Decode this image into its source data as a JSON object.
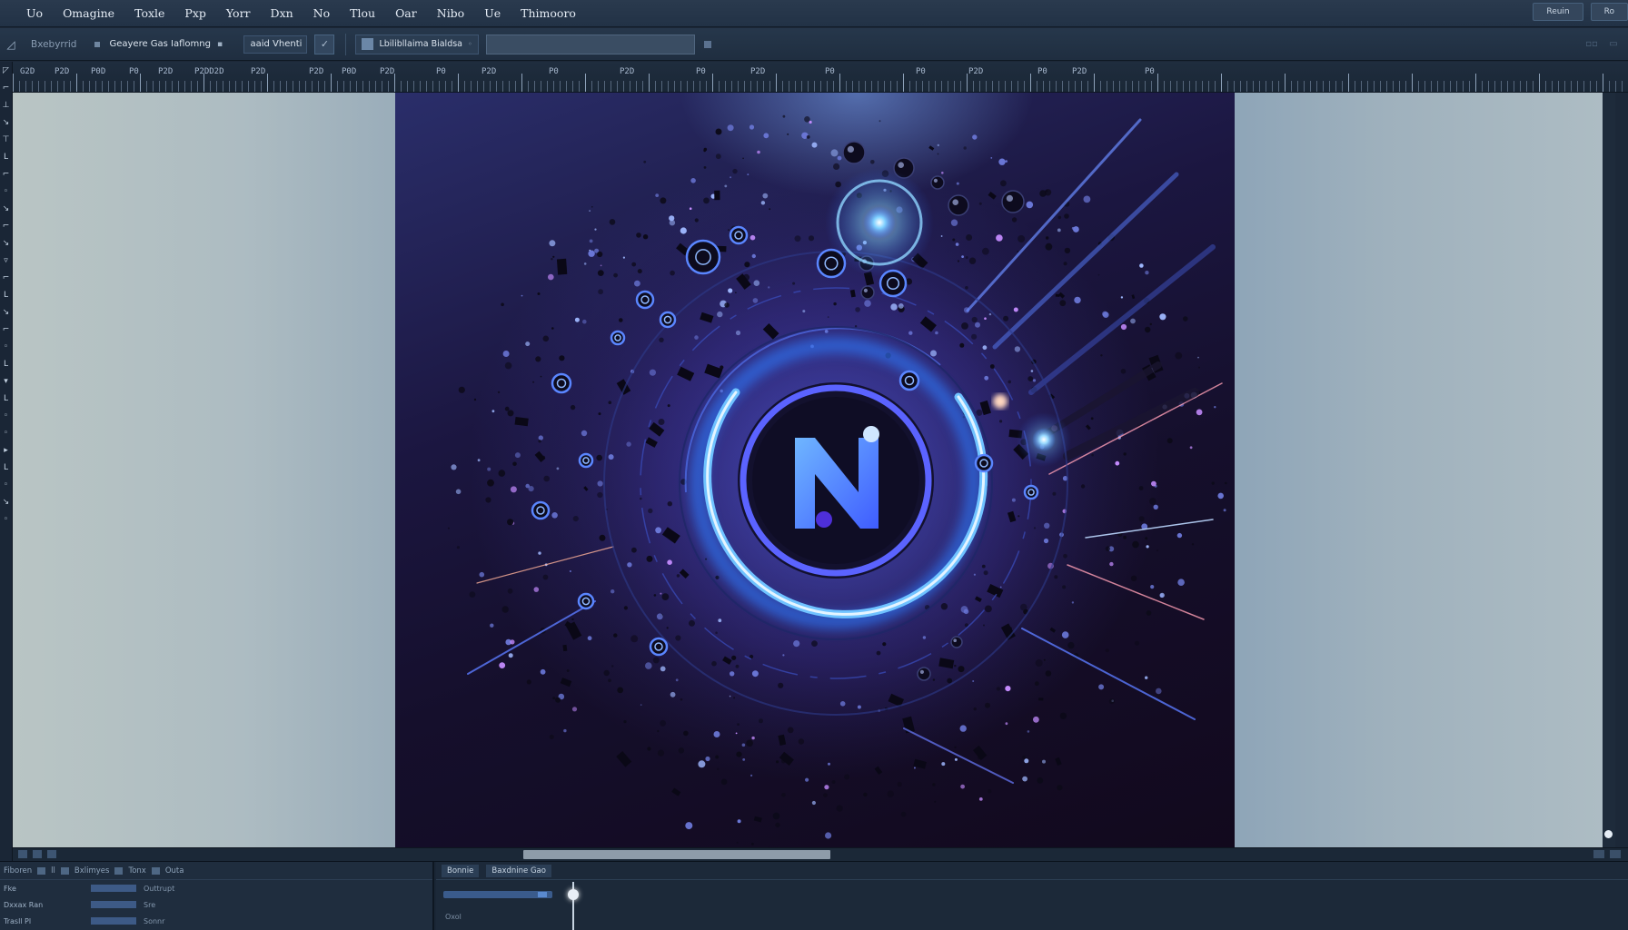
{
  "menubar": {
    "items": [
      "Uo",
      "Omagine",
      "Toxle",
      "Pxp",
      "Yorr",
      "Dxn",
      "No",
      "Tlou",
      "Oar",
      "Nibo",
      "Ue",
      "Thimooro"
    ],
    "right_buttons": [
      "Reuin",
      "Ro"
    ]
  },
  "optionsbar": {
    "label": "Bxebyrrid",
    "select_a": "Geayere Gas Iaflomng",
    "select_b": "aaid Vhenti",
    "preset": "Lbilibllaima Bialdsa"
  },
  "ruler": {
    "labels": [
      "G2D",
      "P2D",
      "P0D",
      "P0",
      "P2D",
      "P2DD2D",
      "P2D",
      "P2D",
      "P0D",
      "P2D",
      "P0",
      "P2D",
      "P0",
      "P2D",
      "P0",
      "P2D",
      "P0",
      "P0",
      "P2D",
      "P0",
      "P2D",
      "P0"
    ]
  },
  "toolbar": {
    "tools": [
      "◸",
      "⌐",
      "⊥",
      "↘",
      "⊤",
      "L",
      "⌐",
      "◦",
      "↘",
      "⌐",
      "↘",
      "▿",
      "⌐",
      "L",
      "↘",
      "⌐",
      "◦",
      "L",
      "▾",
      "L",
      "◦",
      "◦",
      "▸",
      "L",
      "◦",
      "↘",
      "◦"
    ]
  },
  "artwork": {
    "logo_letter": "N",
    "accent": "#3a8cff",
    "glow": "#7fd0ff",
    "background": "#150f2c"
  },
  "bottom_left": {
    "tabs": [
      "Fiboren",
      "ll",
      "Bxlimyes",
      "Tonx",
      "Outa"
    ],
    "rows": [
      {
        "label": "Fke",
        "value": "Outtrupt"
      },
      {
        "label": "Dxxax Ran",
        "value": "Sre"
      },
      {
        "label": "Trasll Pl",
        "value": "Sonnr"
      }
    ]
  },
  "bottom_right": {
    "tabs": [
      "Bonnie",
      "Baxdnine Gao"
    ],
    "sub": "Oxol"
  }
}
